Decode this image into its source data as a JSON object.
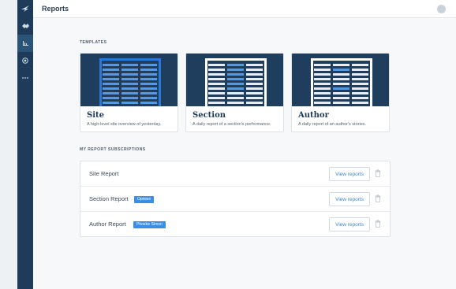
{
  "header": {
    "title": "Reports"
  },
  "sidebar": {
    "items": [
      {
        "icon": "bird-logo-icon",
        "active": false
      },
      {
        "icon": "handshake-icon",
        "active": false
      },
      {
        "icon": "bar-chart-icon",
        "active": true
      },
      {
        "icon": "target-icon",
        "active": false
      },
      {
        "icon": "more-icon",
        "active": false
      }
    ]
  },
  "templates": {
    "label": "TEMPLATES",
    "cards": [
      {
        "name": "Site",
        "description": "A high-level site overview of yesterday."
      },
      {
        "name": "Section",
        "description": "A daily report of a section's performance."
      },
      {
        "name": "Author",
        "description": "A daily report of an author's stories."
      }
    ]
  },
  "subscriptions": {
    "label": "MY REPORT SUBSCRIPTIONS",
    "view_label": "View reports",
    "rows": [
      {
        "name": "Site Report",
        "tag": ""
      },
      {
        "name": "Section Report",
        "tag": "Opinion"
      },
      {
        "name": "Author Report",
        "tag": "Phoebe Simon"
      }
    ]
  },
  "colors": {
    "sidebar": "#1e3c5a",
    "accent": "#3b8ee6",
    "thumb_bg": "#1f3d5d"
  }
}
